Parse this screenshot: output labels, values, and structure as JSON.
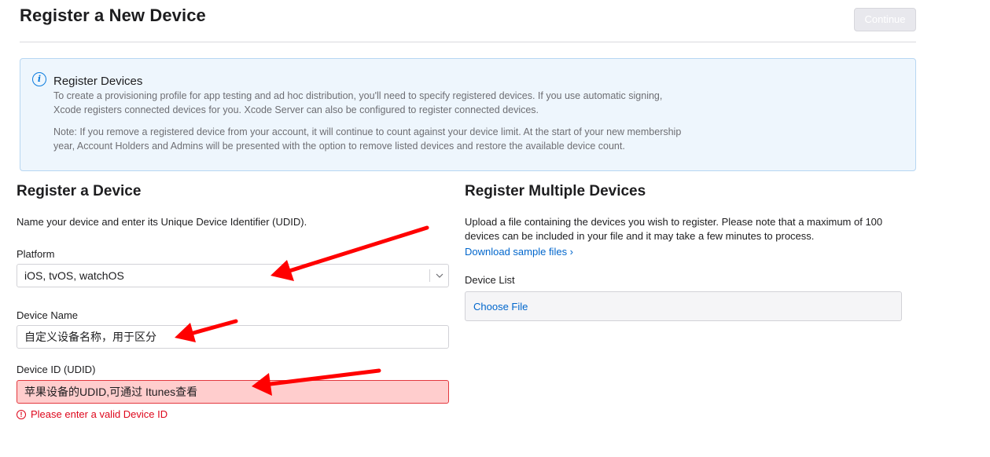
{
  "header": {
    "title": "Register a New Device",
    "continue_label": "Continue"
  },
  "info": {
    "icon": "info-icon",
    "title": "Register Devices",
    "paragraph1": "To create a provisioning profile for app testing and ad hoc distribution, you'll need to specify registered devices. If you use automatic signing, Xcode registers connected devices for you. Xcode Server can also be configured to register connected devices.",
    "paragraph2": "Note: If you remove a registered device from your account, it will continue to count against your device limit. At the start of your new membership year, Account Holders and Admins will be presented with the option to remove listed devices and restore the available device count."
  },
  "single": {
    "title": "Register a Device",
    "description": "Name your device and enter its Unique Device Identifier (UDID).",
    "platform_label": "Platform",
    "platform_value": "iOS, tvOS, watchOS",
    "name_label": "Device Name",
    "name_value": "自定义设备名称，用于区分",
    "udid_label": "Device ID (UDID)",
    "udid_value": "苹果设备的UDID,可通过 Itunes查看",
    "error_text": "Please enter a valid Device ID"
  },
  "multiple": {
    "title": "Register Multiple Devices",
    "description": "Upload a file containing the devices you wish to register. Please note that a maximum of 100 devices can be included in your file and it may take a few minutes to process.",
    "download_link": "Download sample files ›",
    "list_label": "Device List",
    "choose_file": "Choose File"
  },
  "colors": {
    "accent": "#0066cc",
    "error": "#de071c",
    "annotation_arrow": "#ff0000",
    "info_bg": "#eef6fd"
  }
}
